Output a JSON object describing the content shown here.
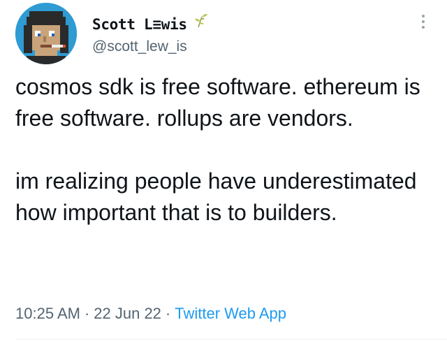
{
  "tweet": {
    "author": {
      "display_name": "Scott L≡wis",
      "handle": "@scott_lew_is",
      "badge_icon": "sprout-icon",
      "avatar_bg": "#2e9bd3"
    },
    "text_paragraphs": [
      "cosmos sdk is free software. ethereum is free software. rollups are vendors.",
      "im realizing people have underestimated how important that is to builders."
    ],
    "time": "10:25 AM",
    "date": "22 Jun 22",
    "separator": "·",
    "source": "Twitter Web App",
    "more_icon": "more-vertical-icon"
  },
  "colors": {
    "text_primary": "#0f1419",
    "text_secondary": "#536471",
    "link": "#1d9bf0"
  }
}
